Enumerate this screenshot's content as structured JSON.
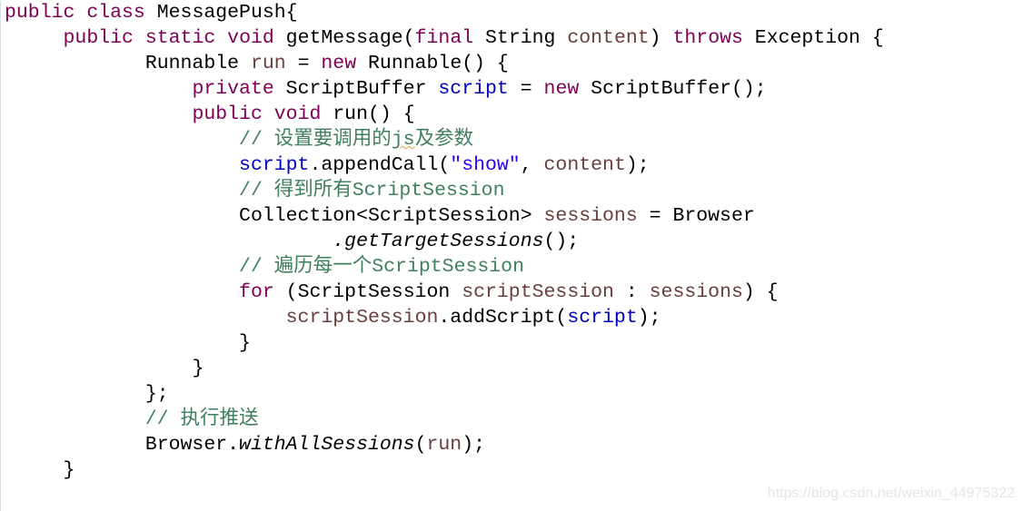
{
  "colors": {
    "keyword": "#7f0055",
    "field": "#0000c0",
    "local": "#6a3e3e",
    "comment": "#3f7f5f",
    "string": "#2a00ff",
    "plain": "#000000"
  },
  "lines": [
    {
      "indent": 0,
      "t": [
        {
          "c": "kw",
          "text": "public"
        },
        {
          "text": " "
        },
        {
          "c": "kw",
          "text": "class"
        },
        {
          "text": " MessagePush{"
        }
      ]
    },
    {
      "indent": 5,
      "t": [
        {
          "c": "kw",
          "text": "public"
        },
        {
          "text": " "
        },
        {
          "c": "kw",
          "text": "static"
        },
        {
          "text": " "
        },
        {
          "c": "kw",
          "text": "void"
        },
        {
          "text": " getMessage("
        },
        {
          "c": "kw",
          "text": "final"
        },
        {
          "text": " String "
        },
        {
          "c": "local",
          "text": "content"
        },
        {
          "text": ") "
        },
        {
          "c": "kw",
          "text": "throws"
        },
        {
          "text": " Exception {"
        }
      ]
    },
    {
      "indent": 12,
      "t": [
        {
          "text": "Runnable "
        },
        {
          "c": "local",
          "text": "run"
        },
        {
          "text": " = "
        },
        {
          "c": "kw",
          "text": "new"
        },
        {
          "text": " Runnable() {"
        }
      ]
    },
    {
      "indent": 16,
      "t": [
        {
          "c": "kw",
          "text": "private"
        },
        {
          "text": " ScriptBuffer "
        },
        {
          "c": "field",
          "text": "script"
        },
        {
          "text": " = "
        },
        {
          "c": "kw",
          "text": "new"
        },
        {
          "text": " ScriptBuffer();"
        }
      ]
    },
    {
      "indent": 16,
      "t": [
        {
          "c": "kw",
          "text": "public"
        },
        {
          "text": " "
        },
        {
          "c": "kw",
          "text": "void"
        },
        {
          "text": " run() {"
        }
      ]
    },
    {
      "indent": 20,
      "t": [
        {
          "c": "comment",
          "text": "// 设置要调用的"
        },
        {
          "c": "comment squiggle",
          "text": "js"
        },
        {
          "c": "comment",
          "text": "及参数"
        }
      ]
    },
    {
      "indent": 20,
      "t": [
        {
          "c": "field",
          "text": "script"
        },
        {
          "text": ".appendCall("
        },
        {
          "c": "string",
          "text": "\"show\""
        },
        {
          "text": ", "
        },
        {
          "c": "local",
          "text": "content"
        },
        {
          "text": ");"
        }
      ]
    },
    {
      "indent": 20,
      "t": [
        {
          "c": "comment",
          "text": "// 得到所有ScriptSession"
        }
      ]
    },
    {
      "indent": 20,
      "t": [
        {
          "text": "Collection<ScriptSession> "
        },
        {
          "c": "local",
          "text": "sessions"
        },
        {
          "text": " = Browser"
        }
      ]
    },
    {
      "indent": 28,
      "t": [
        {
          "c": "italic",
          "text": ".getTargetSessions"
        },
        {
          "text": "();"
        }
      ]
    },
    {
      "indent": 20,
      "t": [
        {
          "c": "comment",
          "text": "// 遍历每一个ScriptSession"
        }
      ]
    },
    {
      "indent": 20,
      "t": [
        {
          "c": "kw",
          "text": "for"
        },
        {
          "text": " (ScriptSession "
        },
        {
          "c": "local",
          "text": "scriptSession"
        },
        {
          "text": " : "
        },
        {
          "c": "local",
          "text": "sessions"
        },
        {
          "text": ") {"
        }
      ]
    },
    {
      "indent": 24,
      "t": [
        {
          "c": "local",
          "text": "scriptSession"
        },
        {
          "text": ".addScript("
        },
        {
          "c": "field",
          "text": "script"
        },
        {
          "text": ");"
        }
      ]
    },
    {
      "indent": 20,
      "t": [
        {
          "text": "}"
        }
      ]
    },
    {
      "indent": 16,
      "t": [
        {
          "text": "}"
        }
      ]
    },
    {
      "indent": 12,
      "t": [
        {
          "text": "};"
        }
      ]
    },
    {
      "indent": 12,
      "t": [
        {
          "c": "comment",
          "text": "// 执行推送"
        }
      ]
    },
    {
      "indent": 12,
      "t": [
        {
          "text": "Browser."
        },
        {
          "c": "italic",
          "text": "withAllSessions"
        },
        {
          "text": "("
        },
        {
          "c": "local",
          "text": "run"
        },
        {
          "text": ");"
        }
      ]
    },
    {
      "indent": 5,
      "t": [
        {
          "text": "}"
        }
      ]
    }
  ],
  "watermark": "https://blog.csdn.net/weixin_44975322"
}
